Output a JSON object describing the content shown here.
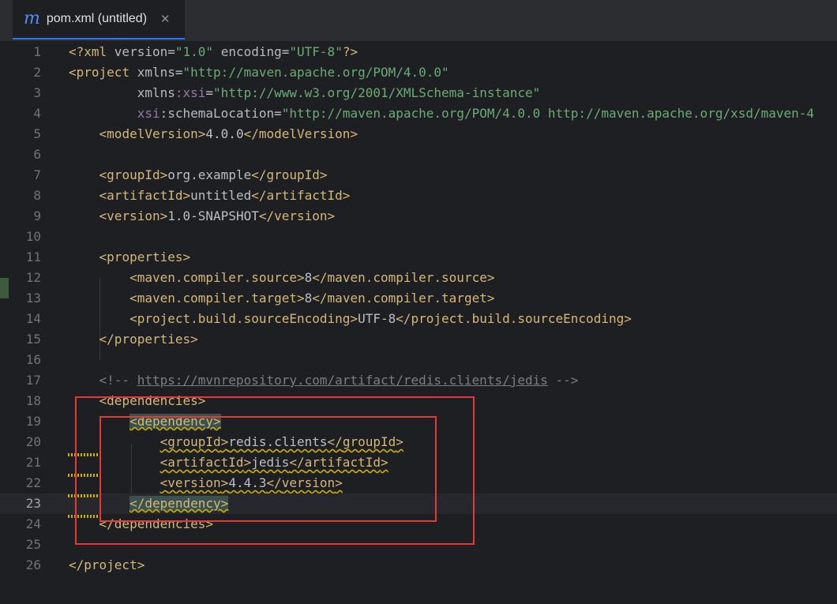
{
  "tab": {
    "icon_glyph": "m",
    "title": "pom.xml (untitled)",
    "close_glyph": "✕",
    "accent_color": "#3574f0"
  },
  "editor": {
    "current_line": 23,
    "lines": [
      {
        "n": "1",
        "parts": [
          [
            "br",
            "<?"
          ],
          [
            "tg",
            "xml "
          ],
          [
            "at",
            "version"
          ],
          [
            "p",
            "="
          ],
          [
            "vl",
            "\"1.0\""
          ],
          [
            "p",
            " "
          ],
          [
            "at",
            "encoding"
          ],
          [
            "p",
            "="
          ],
          [
            "vl",
            "\"UTF-8\""
          ],
          [
            "br",
            "?>"
          ]
        ]
      },
      {
        "n": "2",
        "parts": [
          [
            "br",
            "<"
          ],
          [
            "tg",
            "project "
          ],
          [
            "at",
            "xmlns"
          ],
          [
            "p",
            "="
          ],
          [
            "vl",
            "\"http://maven.apache.org/POM/4.0.0\""
          ]
        ]
      },
      {
        "n": "3",
        "parts": [
          [
            "p",
            "         "
          ],
          [
            "at",
            "xmlns"
          ],
          [
            "ns",
            ":xsi"
          ],
          [
            "p",
            "="
          ],
          [
            "vl",
            "\"http://www.w3.org/2001/XMLSchema-instance\""
          ]
        ]
      },
      {
        "n": "4",
        "parts": [
          [
            "p",
            "         "
          ],
          [
            "ns",
            "xsi"
          ],
          [
            "at",
            ":schemaLocation"
          ],
          [
            "p",
            "="
          ],
          [
            "vl",
            "\"http://maven.apache.org/POM/4.0.0 http://maven.apache.org/xsd/maven-4"
          ]
        ]
      },
      {
        "n": "5",
        "parts": [
          [
            "p",
            "    "
          ],
          [
            "br",
            "<"
          ],
          [
            "tg",
            "modelVersion"
          ],
          [
            "br",
            ">"
          ],
          [
            "p",
            "4.0.0"
          ],
          [
            "br",
            "</"
          ],
          [
            "tg",
            "modelVersion"
          ],
          [
            "br",
            ">"
          ]
        ]
      },
      {
        "n": "6",
        "parts": []
      },
      {
        "n": "7",
        "parts": [
          [
            "p",
            "    "
          ],
          [
            "br",
            "<"
          ],
          [
            "tg",
            "groupId"
          ],
          [
            "br",
            ">"
          ],
          [
            "p",
            "org.example"
          ],
          [
            "br",
            "</"
          ],
          [
            "tg",
            "groupId"
          ],
          [
            "br",
            ">"
          ]
        ]
      },
      {
        "n": "8",
        "parts": [
          [
            "p",
            "    "
          ],
          [
            "br",
            "<"
          ],
          [
            "tg",
            "artifactId"
          ],
          [
            "br",
            ">"
          ],
          [
            "p",
            "untitled"
          ],
          [
            "br",
            "</"
          ],
          [
            "tg",
            "artifactId"
          ],
          [
            "br",
            ">"
          ]
        ]
      },
      {
        "n": "9",
        "parts": [
          [
            "p",
            "    "
          ],
          [
            "br",
            "<"
          ],
          [
            "tg",
            "version"
          ],
          [
            "br",
            ">"
          ],
          [
            "p",
            "1.0-SNAPSHOT"
          ],
          [
            "br",
            "</"
          ],
          [
            "tg",
            "version"
          ],
          [
            "br",
            ">"
          ]
        ]
      },
      {
        "n": "10",
        "parts": []
      },
      {
        "n": "11",
        "parts": [
          [
            "p",
            "    "
          ],
          [
            "br",
            "<"
          ],
          [
            "tg",
            "properties"
          ],
          [
            "br",
            ">"
          ]
        ]
      },
      {
        "n": "12",
        "parts": [
          [
            "p",
            "        "
          ],
          [
            "br",
            "<"
          ],
          [
            "tg",
            "maven.compiler.source"
          ],
          [
            "br",
            ">"
          ],
          [
            "p",
            "8"
          ],
          [
            "br",
            "</"
          ],
          [
            "tg",
            "maven.compiler.source"
          ],
          [
            "br",
            ">"
          ]
        ]
      },
      {
        "n": "13",
        "parts": [
          [
            "p",
            "        "
          ],
          [
            "br",
            "<"
          ],
          [
            "tg",
            "maven.compiler.target"
          ],
          [
            "br",
            ">"
          ],
          [
            "p",
            "8"
          ],
          [
            "br",
            "</"
          ],
          [
            "tg",
            "maven.compiler.target"
          ],
          [
            "br",
            ">"
          ]
        ]
      },
      {
        "n": "14",
        "parts": [
          [
            "p",
            "        "
          ],
          [
            "br",
            "<"
          ],
          [
            "tg",
            "project.build.sourceEncoding"
          ],
          [
            "br",
            ">"
          ],
          [
            "p",
            "UTF-8"
          ],
          [
            "br",
            "</"
          ],
          [
            "tg",
            "project.build.sourceEncoding"
          ],
          [
            "br",
            ">"
          ]
        ]
      },
      {
        "n": "15",
        "parts": [
          [
            "p",
            "    "
          ],
          [
            "br",
            "</"
          ],
          [
            "tg",
            "properties"
          ],
          [
            "br",
            ">"
          ]
        ]
      },
      {
        "n": "16",
        "parts": []
      },
      {
        "n": "17",
        "parts": [
          [
            "p",
            "    "
          ],
          [
            "cm",
            "<!-- "
          ],
          [
            "url",
            "https://mvnrepository.com/artifact/redis.clients/jedis"
          ],
          [
            "cm",
            " -->"
          ]
        ]
      },
      {
        "n": "18",
        "parts": [
          [
            "p",
            "    "
          ],
          [
            "br",
            "<"
          ],
          [
            "tg",
            "dependencies"
          ],
          [
            "br",
            ">"
          ]
        ]
      },
      {
        "n": "19",
        "parts": [
          [
            "p",
            "        "
          ],
          [
            "hl",
            "<dependency>"
          ]
        ]
      },
      {
        "n": "20",
        "parts": [
          [
            "p",
            "            "
          ],
          [
            "wbr",
            "<"
          ],
          [
            "wtg",
            "groupId"
          ],
          [
            "wbr",
            ">"
          ],
          [
            "wp",
            "redis.clients"
          ],
          [
            "wbr",
            "</"
          ],
          [
            "wtg",
            "groupId"
          ],
          [
            "wbr",
            ">"
          ]
        ]
      },
      {
        "n": "21",
        "parts": [
          [
            "p",
            "            "
          ],
          [
            "wbr",
            "<"
          ],
          [
            "wtg",
            "artifactId"
          ],
          [
            "wbr",
            ">"
          ],
          [
            "wp",
            "jedis"
          ],
          [
            "wbr",
            "</"
          ],
          [
            "wtg",
            "artifactId"
          ],
          [
            "wbr",
            ">"
          ]
        ]
      },
      {
        "n": "22",
        "parts": [
          [
            "p",
            "            "
          ],
          [
            "wbr",
            "<"
          ],
          [
            "wtg",
            "version"
          ],
          [
            "wbr",
            ">"
          ],
          [
            "wp",
            "4.4.3"
          ],
          [
            "wbr",
            "</"
          ],
          [
            "wtg",
            "version"
          ],
          [
            "wbr",
            ">"
          ]
        ]
      },
      {
        "n": "23",
        "parts": [
          [
            "p",
            "        "
          ],
          [
            "hl",
            "</dependency>"
          ]
        ]
      },
      {
        "n": "24",
        "parts": [
          [
            "p",
            "    "
          ],
          [
            "br",
            "</"
          ],
          [
            "tg",
            "dependencies"
          ],
          [
            "br",
            ">"
          ]
        ]
      },
      {
        "n": "25",
        "parts": []
      },
      {
        "n": "26",
        "parts": [
          [
            "br",
            "</"
          ],
          [
            "tg",
            "project"
          ],
          [
            "br",
            ">"
          ]
        ]
      }
    ]
  },
  "colors": {
    "background": "#1e1f22",
    "tag": "#d5b778",
    "string": "#6aab73",
    "namespace": "#9876aa",
    "comment": "#7a7e85",
    "highlight_box": "#e53935"
  }
}
